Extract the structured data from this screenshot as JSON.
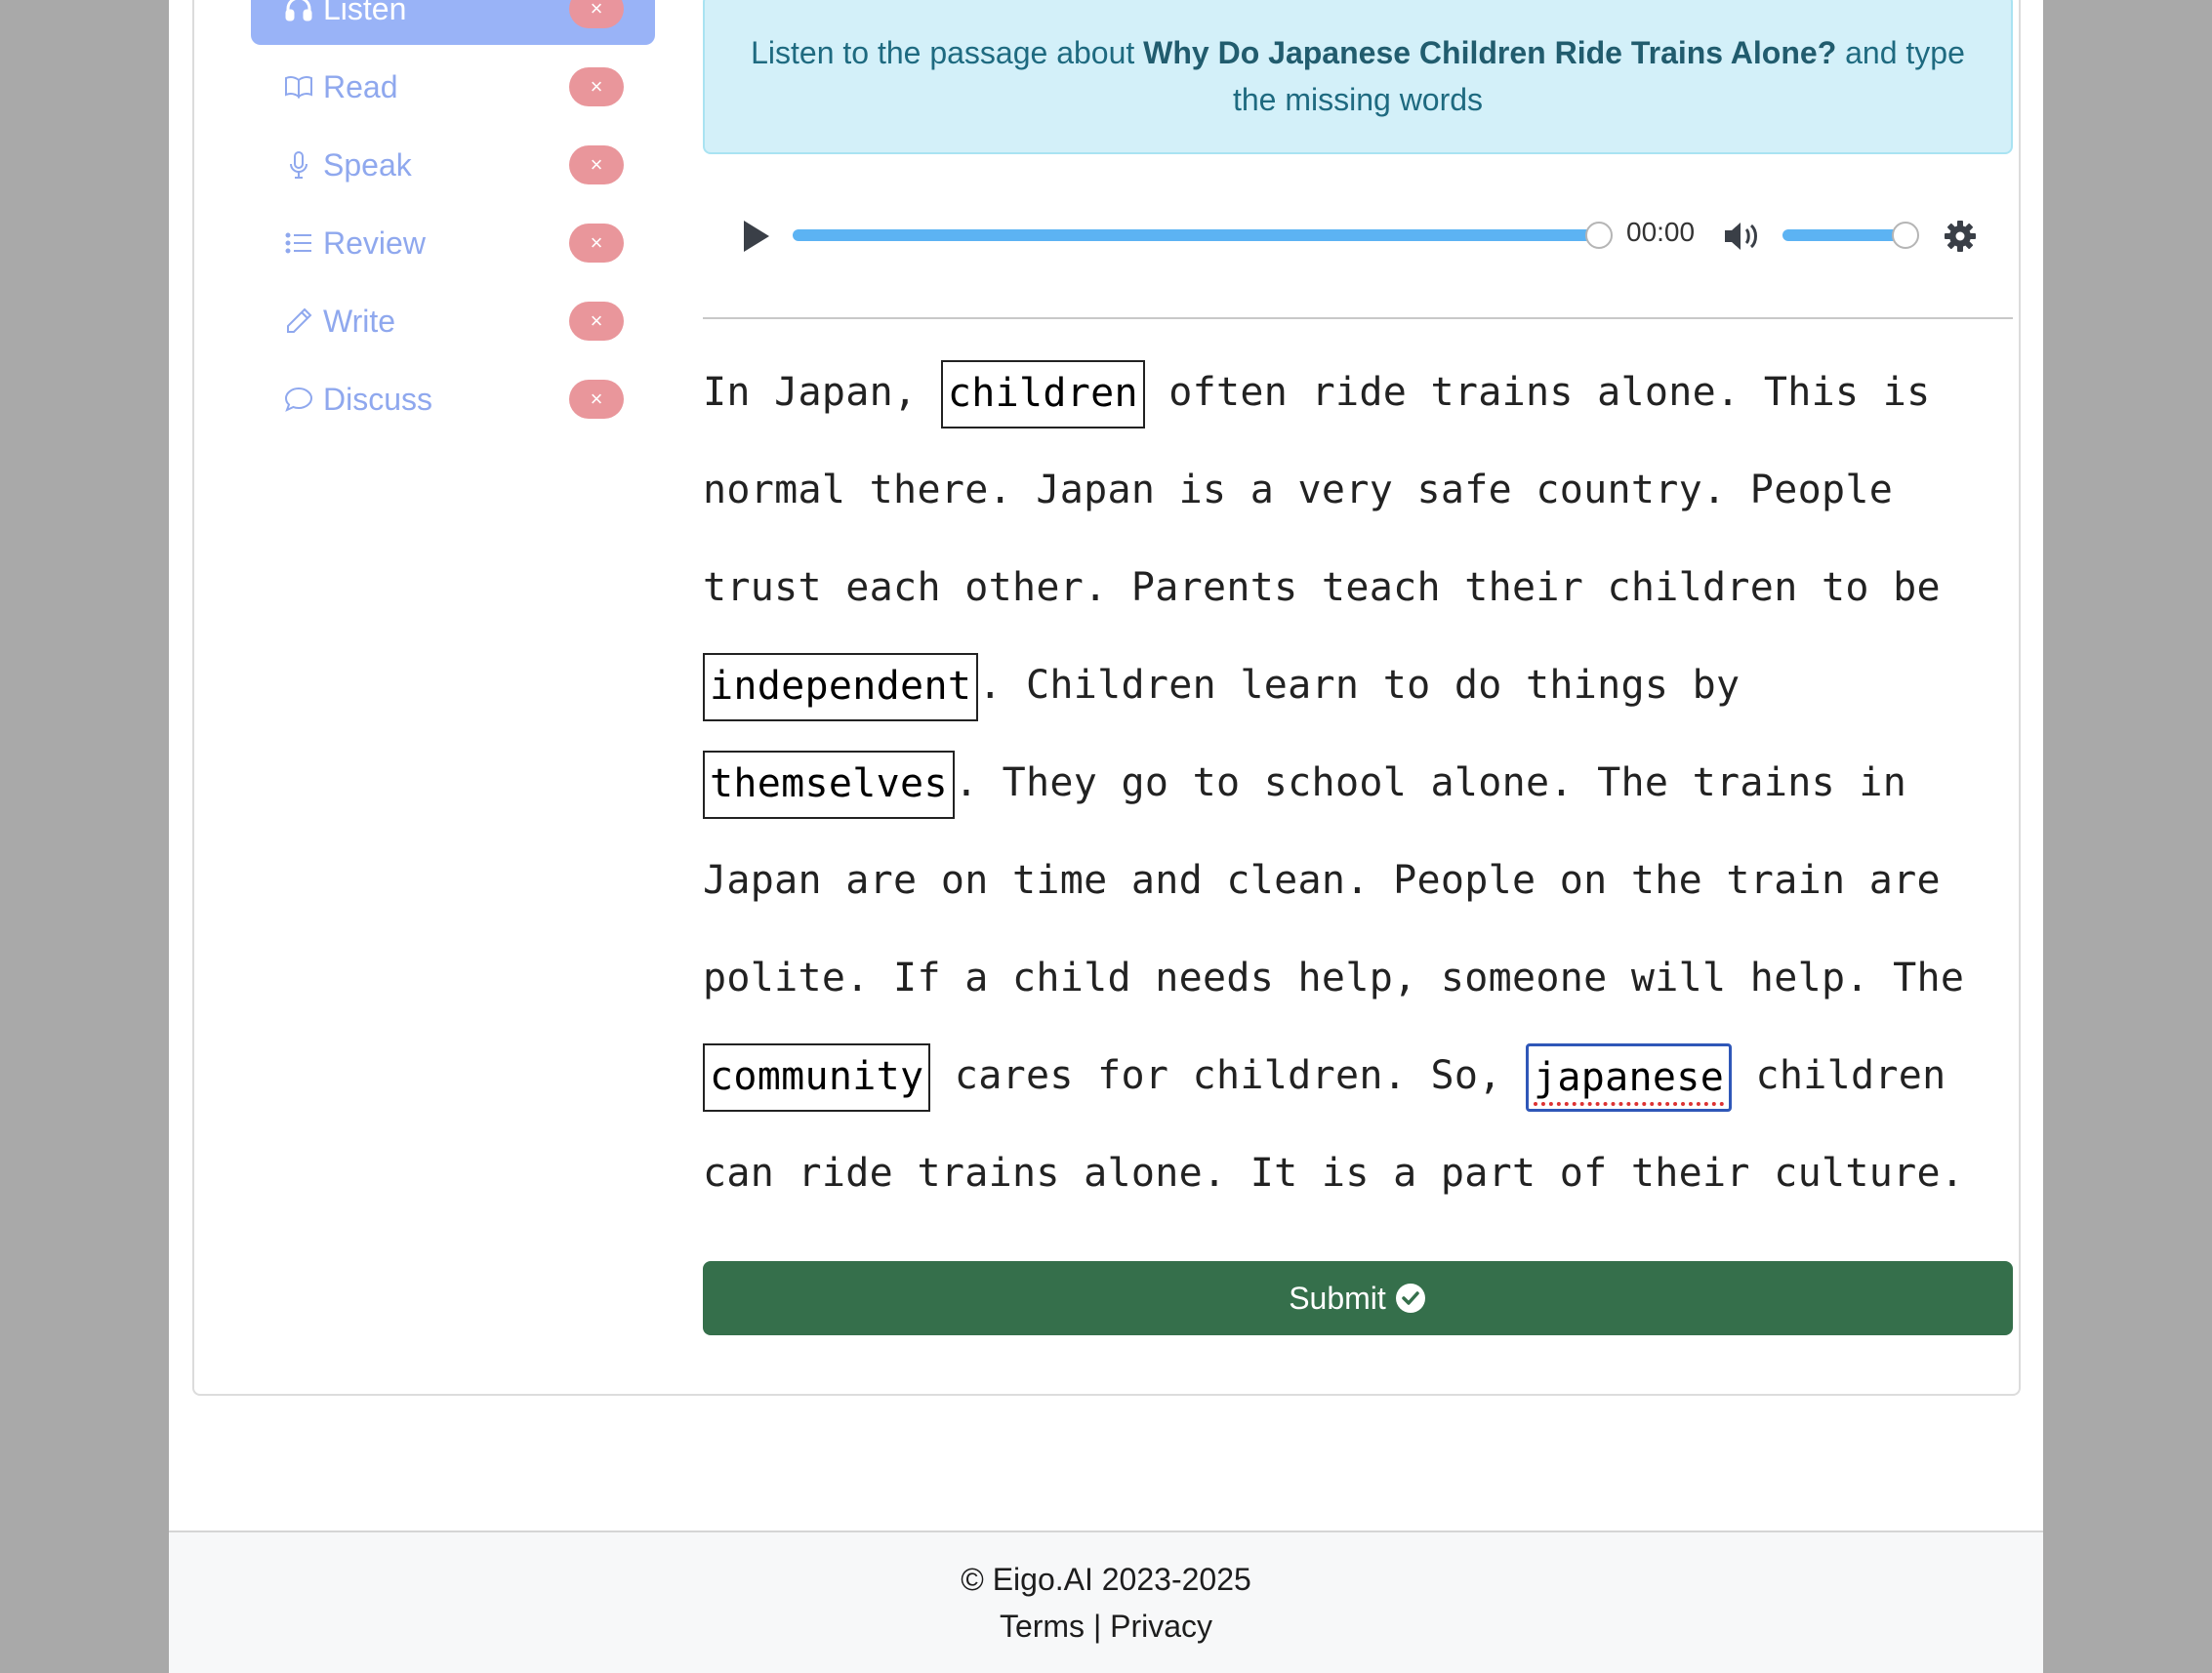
{
  "sidebar": {
    "items": [
      {
        "label": "Listen",
        "icon": "headphones-icon",
        "badge": "×",
        "active": true
      },
      {
        "label": "Read",
        "icon": "book-icon",
        "badge": "×",
        "active": false
      },
      {
        "label": "Speak",
        "icon": "microphone-icon",
        "badge": "×",
        "active": false
      },
      {
        "label": "Review",
        "icon": "list-icon",
        "badge": "×",
        "active": false
      },
      {
        "label": "Write",
        "icon": "pencil-icon",
        "badge": "×",
        "active": false
      },
      {
        "label": "Discuss",
        "icon": "chat-bubble-icon",
        "badge": "×",
        "active": false
      }
    ]
  },
  "instructions": {
    "prefix": "Listen to the passage about ",
    "title": "Why Do Japanese Children Ride Trains Alone?",
    "suffix": " and type the missing words"
  },
  "player": {
    "time": "00:00",
    "progress": 1.0,
    "volume": 1.0
  },
  "passage": {
    "t0": "In Japan, ",
    "b0": "children",
    "t1": " often ride trains alone. This is normal there. Japan is a very safe country. People trust each other. Parents teach their children to be ",
    "b1": "independent",
    "t2": ". Children learn to do things by ",
    "b2": "themselves",
    "t3": ". They go to school alone. The trains in Japan are on time and clean. People on the train are polite. If a child needs help, someone will help. The ",
    "b3": "community",
    "t4": " cares for children. So, ",
    "b4": "japanese",
    "t5": " children can ride trains alone. It is a part of their culture."
  },
  "submit_label": "Submit",
  "footer": {
    "copyright": "© Eigo.AI 2023-2025",
    "terms": "Terms",
    "separator": " | ",
    "privacy": "Privacy"
  },
  "colors": {
    "active_nav": "#99b3f7",
    "nav_text": "#8fa8ee",
    "badge": "#e9969b",
    "alert_bg": "#d3f0f9",
    "submit": "#356f4b",
    "progress": "#5cb3f3"
  }
}
